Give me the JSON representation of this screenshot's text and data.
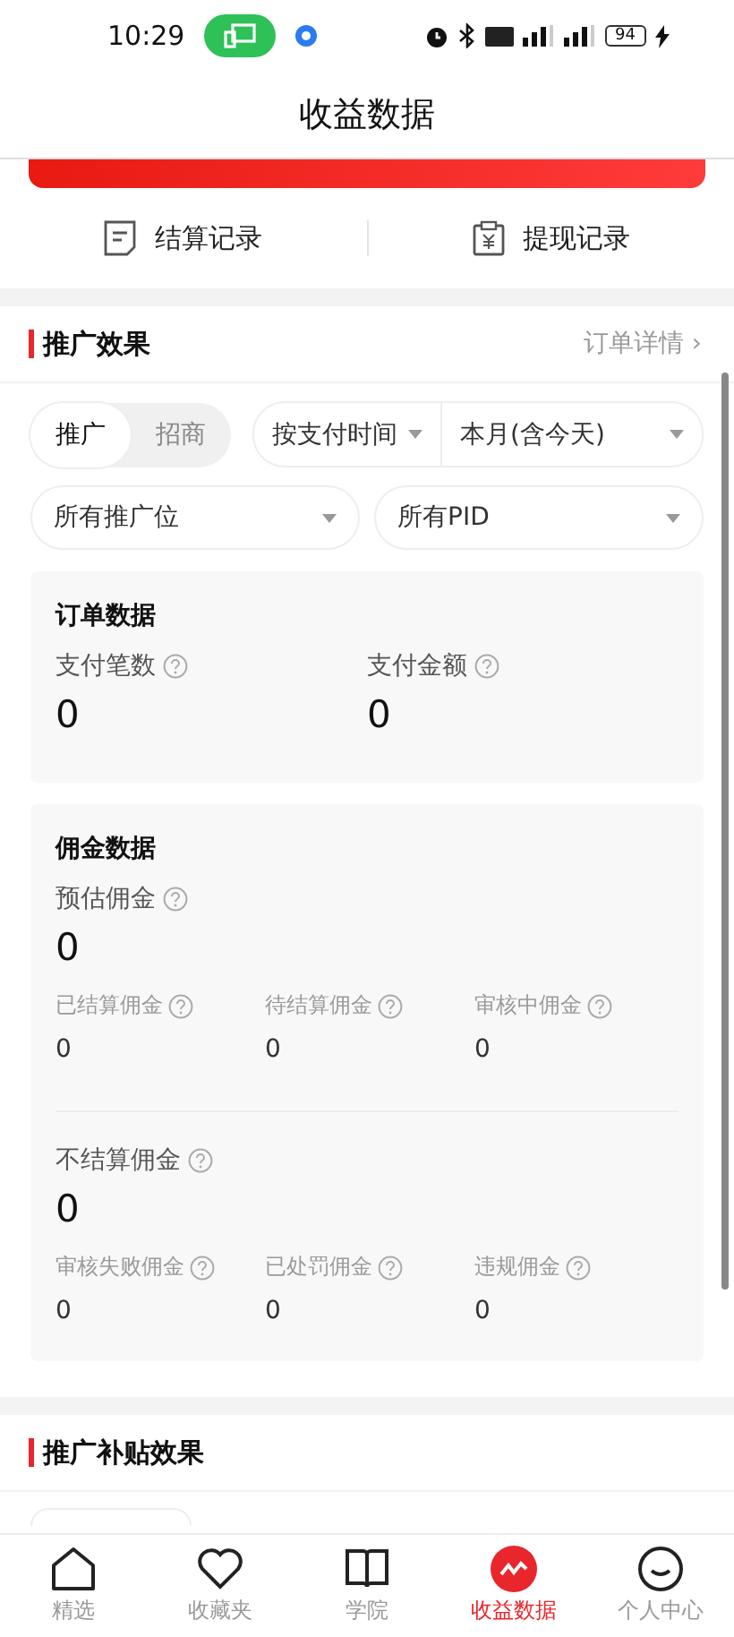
{
  "status_bar": {
    "time": "10:29",
    "battery": "94"
  },
  "header": {
    "title": "收益数据"
  },
  "records": [
    {
      "label": "结算记录",
      "kind": "list"
    },
    {
      "label": "提现记录",
      "kind": "yuan"
    }
  ],
  "promo_section": {
    "title": "推广效果",
    "link": "订单详情",
    "chevron": "›",
    "tabs": [
      {
        "label": "推广",
        "selected": true
      },
      {
        "label": "招商",
        "selected": false
      }
    ],
    "time_filter": {
      "mode": "按支付时间",
      "range": "本月(含今天)"
    },
    "filters": [
      {
        "value": "所有推广位"
      },
      {
        "value": "所有PID"
      }
    ],
    "order_card": {
      "title": "订单数据",
      "metrics": [
        {
          "label": "支付笔数",
          "value": "0"
        },
        {
          "label": "支付金额",
          "value": "0"
        }
      ]
    },
    "commission_card": {
      "title": "佣金数据",
      "groups": [
        {
          "label": "预估佣金",
          "value": "0",
          "items": [
            {
              "label": "已结算佣金",
              "value": "0"
            },
            {
              "label": "待结算佣金",
              "value": "0"
            },
            {
              "label": "审核中佣金",
              "value": "0"
            }
          ]
        },
        {
          "label": "不结算佣金",
          "value": "0",
          "items": [
            {
              "label": "审核失败佣金",
              "value": "0"
            },
            {
              "label": "已处罚佣金",
              "value": "0"
            },
            {
              "label": "违规佣金",
              "value": "0"
            }
          ]
        }
      ]
    }
  },
  "subsidy_section": {
    "title": "推广补贴效果"
  },
  "tab_bar": [
    {
      "label": "精选",
      "kind": "home",
      "selected": false
    },
    {
      "label": "收藏夹",
      "kind": "heart",
      "selected": false
    },
    {
      "label": "学院",
      "kind": "book",
      "selected": false
    },
    {
      "label": "收益数据",
      "kind": "chart",
      "selected": true
    },
    {
      "label": "个人中心",
      "kind": "face",
      "selected": false
    }
  ]
}
